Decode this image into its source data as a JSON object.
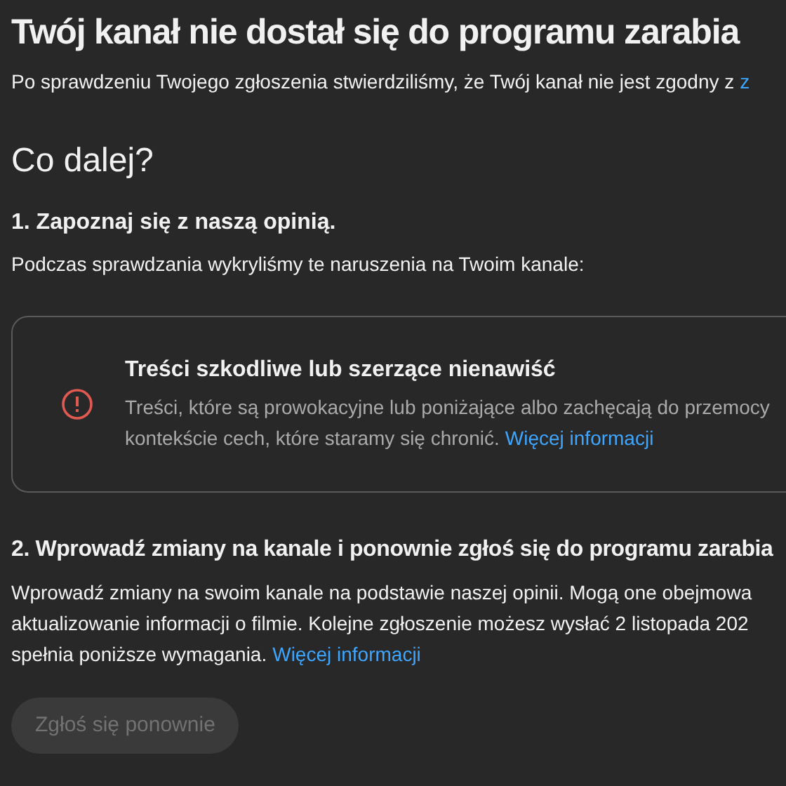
{
  "title": "Twój kanał nie dostał się do programu zarabia",
  "intro": {
    "text": "Po sprawdzeniu Twojego zgłoszenia stwierdziliśmy, że Twój kanał nie jest zgodny z",
    "link": "z"
  },
  "next_heading": "Co dalej?",
  "step_1": {
    "heading": "1. Zapoznaj się z naszą opinią.",
    "text": "Podczas sprawdzania wykryliśmy te naruszenia na Twoim kanale:"
  },
  "violations": [
    {
      "title": "Treści szkodliwe lub szerzące nienawiść",
      "lines": [
        "Treści, które są prowokacyjne lub poniżające albo zachęcają do przemocy",
        "kontekście cech, które staramy się chronić."
      ],
      "link": "Więcej informacji"
    }
  ],
  "step_2": {
    "heading": "2. Wprowadź zmiany na kanale i ponownie zgłoś się do programu zarabia",
    "lines": [
      "Wprowadź zmiany na swoim kanale na podstawie naszej opinii. Mogą one obejmowa",
      "aktualizowanie informacji o filmie. Kolejne zgłoszenie możesz wysłać 2 listopada 202",
      "spełnia poniższe wymagania."
    ],
    "link": "Więcej informacji"
  },
  "reapply_button": {
    "label": "Zgłoś się ponownie",
    "disabled": true
  }
}
